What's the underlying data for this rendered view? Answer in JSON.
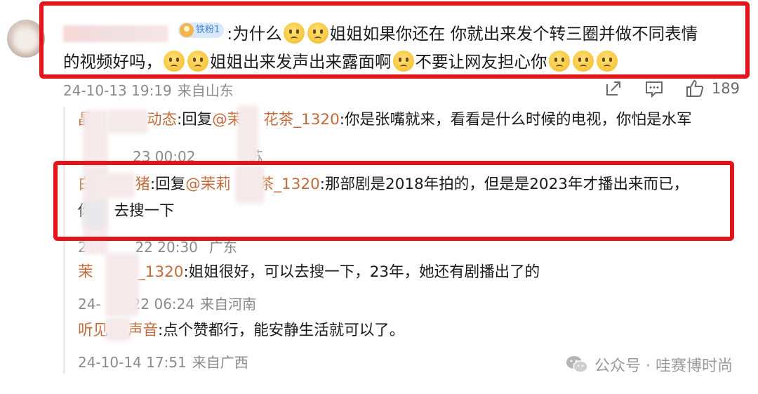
{
  "main_comment": {
    "badge": "铁粉1",
    "text_part1": ":为什么",
    "text_part2": "姐姐如果你还在 你就出来发个转三圈并做不同表情",
    "text_part3": "的视频好吗，",
    "text_part4": "姐姐出来发声出来露面啊",
    "text_part5": "不要让网友担心你",
    "date": "24-10-13 19:19",
    "location": "来自山东",
    "like_count": "189"
  },
  "replies": [
    {
      "name_suffix": "动态",
      "prefix": ":回复",
      "mention": "@茉",
      "mention_tail": "花茶_1320",
      "body": ":你是张嘴就来，看看是什么时候的电视，你怕是水军",
      "date_tail": "23 00:02",
      "location_tail": "苏"
    },
    {
      "name_head": "白",
      "name_tail": "猪",
      "prefix": ":回复",
      "mention": "@茉莉",
      "mention_tail": "茶_1320",
      "body": ":那部剧是2018年拍的，但是是2023年才播出来而已，",
      "line2_head": "你",
      "line2_tail": "去搜一下",
      "date_head": "24",
      "date_tail": "22 20:30",
      "location_tail": "广东"
    },
    {
      "name_head": "茉",
      "name_tail": "茶_1320",
      "body": ":姐姐很好，可以去搜一下，23年，她还有剧播出了的",
      "date_head": "24-",
      "date_tail": "22 06:24",
      "location": "来自河南"
    },
    {
      "name_head": "听见",
      "name_tail": "声音",
      "body": ":点个赞都行，能安静生活就可以了。",
      "date": "24-10-14 17:51",
      "location": "来自广西"
    }
  ],
  "watermark": {
    "text": "公众号 · 哇赛博时尚"
  },
  "colors": {
    "highlight_red": "#e4141b",
    "username_orange": "#c56a3a",
    "meta_grey": "#8a8a8a"
  },
  "icons": {
    "share": "share-icon",
    "comment": "comment-icon",
    "like": "thumbs-up-icon",
    "watermark": "wechat-icon"
  }
}
